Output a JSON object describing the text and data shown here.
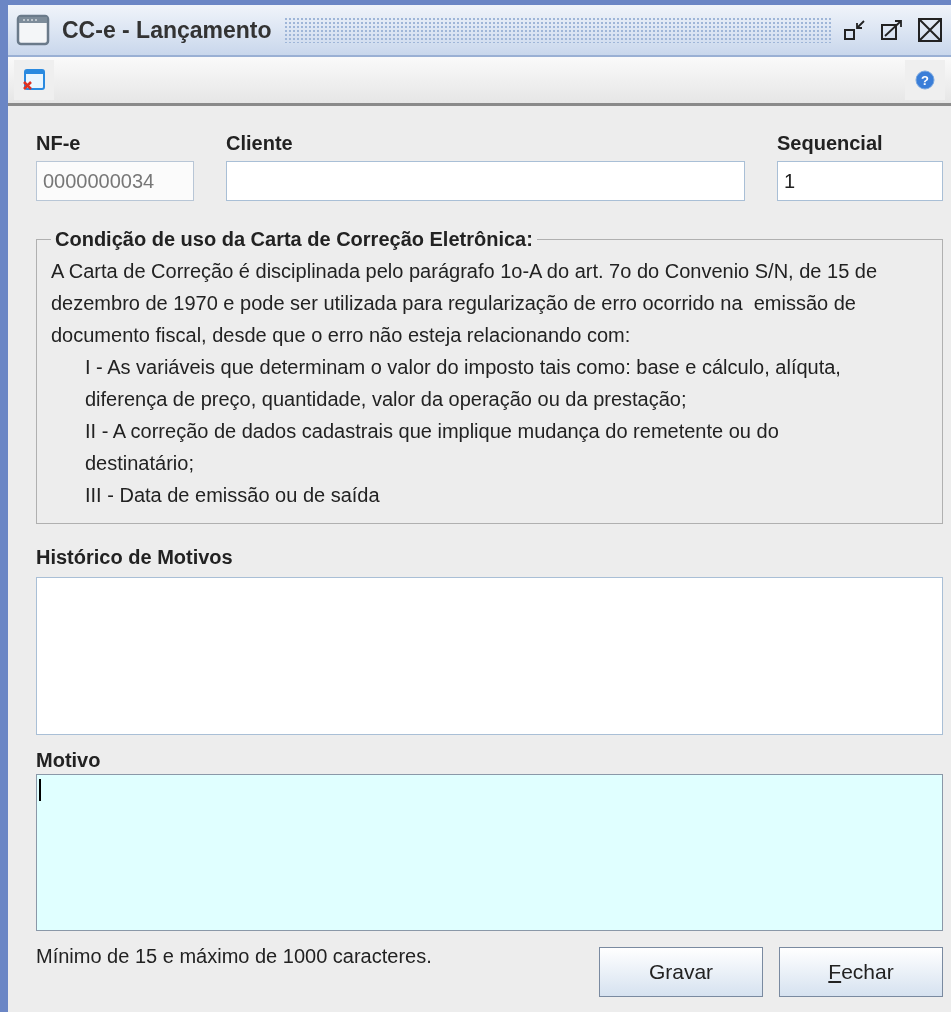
{
  "window": {
    "title": "CC-e - Lançamento"
  },
  "fields": [
    {
      "label": "NF-e",
      "value": "0000000034",
      "disabled": true
    },
    {
      "label": "Cliente",
      "disabled": false
    },
    {
      "label": "Sequencial",
      "value": "1",
      "disabled": false
    }
  ],
  "conditions": {
    "title": "Condição de uso da Carta de Correção Eletrônica:",
    "intro": "A Carta de Correção é disciplinada pelo parágrafo 1o-A do art. 7o do Convenio S/N, de 15 de dezembro de 1970 e pode ser utilizada para regularização de erro ocorrido na  emissão de documento fiscal, desde que o erro não esteja relacionando com:",
    "items": [
      "I - As variáveis que determinam o valor do imposto tais como: base e cálculo, alíquta, diferença de preço, quantidade, valor da operação ou da prestação;",
      "II - A correção de dados cadastrais que implique mudança do remetente ou do destinatário;",
      "III - Data de emissão ou de saída"
    ]
  },
  "toolbar": {
    "help_glyph": "?"
  },
  "history": {
    "label": "Histórico de Motivos"
  },
  "reason": {
    "label": "Motivo",
    "focused": true
  },
  "hint": "Mínimo de 15 e máximo de 1000 caracteres.",
  "buttons": [
    {
      "label": "Gravar",
      "mnemonic": false
    },
    {
      "label": "Fechar",
      "mnemonic": true
    }
  ]
}
